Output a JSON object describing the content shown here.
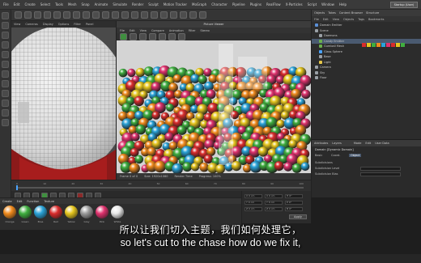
{
  "menubar": {
    "items": [
      "File",
      "Edit",
      "Create",
      "Select",
      "Tools",
      "Mesh",
      "Snap",
      "Animate",
      "Simulate",
      "Render",
      "Sculpt",
      "Motion Tracker",
      "MoGraph",
      "Character",
      "Pipeline",
      "Plugins",
      "RealFlow",
      "X-Particles",
      "Script",
      "Window",
      "Help"
    ],
    "layout_label": "Startup (User)"
  },
  "viewport_left": {
    "menu": [
      "View",
      "Cameras",
      "Display",
      "Options",
      "Filter",
      "Panel"
    ]
  },
  "render_window": {
    "title": "Picture Viewer",
    "menu": [
      "File",
      "Edit",
      "View",
      "Compare",
      "Animation",
      "Filter",
      "Stereo"
    ],
    "status": [
      "Frame 0 of 0",
      "Size: 1920x1080",
      "Render Time",
      "Progress: 100%"
    ]
  },
  "object_panel": {
    "tabs": [
      "Objects",
      "Takes",
      "Content Browser",
      "Structure"
    ],
    "menu": [
      "File",
      "Edit",
      "View",
      "Objects",
      "Tags",
      "Bookmarks"
    ],
    "rows": [
      {
        "label": "Domain Emitter",
        "color": "#5a8fd6",
        "selected": false
      },
      {
        "label": "Scene",
        "color": "#9aa0a6",
        "selected": false
      },
      {
        "label": "Daemons",
        "color": "#9aa0a6",
        "selected": false
      },
      {
        "label": "Candy Emitter",
        "color": "#6ab04c",
        "selected": true
      },
      {
        "label": "Gumball Mesh",
        "color": "#6ab04c",
        "selected": false
      },
      {
        "label": "Glass Sphere",
        "color": "#4aa3ff",
        "selected": false
      },
      {
        "label": "Base",
        "color": "#9aa0a6",
        "selected": false
      },
      {
        "label": "Light",
        "color": "#e6c84a",
        "selected": false
      },
      {
        "label": "Camera",
        "color": "#9aa0a6",
        "selected": false
      },
      {
        "label": "Sky",
        "color": "#9aa0a6",
        "selected": false
      },
      {
        "label": "Floor",
        "color": "#9aa0a6",
        "selected": false
      }
    ]
  },
  "attributes": {
    "tabs": [
      "Attributes",
      "Layers"
    ],
    "menu": [
      "Mode",
      "Edit",
      "User Data"
    ],
    "object_title": "Domain [Dynamic Domain]",
    "lines": [
      "Basic",
      "Coord.",
      "Object",
      "Subdivisions",
      "Subdivision Level",
      "Subdivision Bias"
    ]
  },
  "timeline": {
    "ticks": [
      "0",
      "10",
      "20",
      "30",
      "40",
      "50",
      "60",
      "70",
      "80",
      "90",
      "100"
    ]
  },
  "coordinates": {
    "rows": [
      {
        "a": "X 0 cm",
        "b": "X 0 cm",
        "c": "H 0°"
      },
      {
        "a": "Y 0 cm",
        "b": "Y 0 cm",
        "c": "P 0°"
      },
      {
        "a": "Z 0 cm",
        "b": "Z 0 cm",
        "c": "B 0°"
      }
    ],
    "apply_label": "Apply"
  },
  "materials": {
    "menu": [
      "Create",
      "Edit",
      "Function",
      "Texture"
    ],
    "balls": [
      {
        "name": "Orange",
        "color": "#f08a1c"
      },
      {
        "name": "Green",
        "color": "#3fae3f"
      },
      {
        "name": "Blue",
        "color": "#2aa3d8"
      },
      {
        "name": "Red",
        "color": "#d92c2c"
      },
      {
        "name": "Yellow",
        "color": "#e6c61e"
      },
      {
        "name": "Grey",
        "color": "#9a9a9a"
      },
      {
        "name": "Pink",
        "color": "#e0326e"
      },
      {
        "name": "White",
        "color": "#e8e8e8"
      }
    ]
  },
  "subtitles": {
    "chinese": "所以让我们切入主题，我们如何处理它，",
    "english": "so let's cut to the chase how do we fix it,"
  }
}
